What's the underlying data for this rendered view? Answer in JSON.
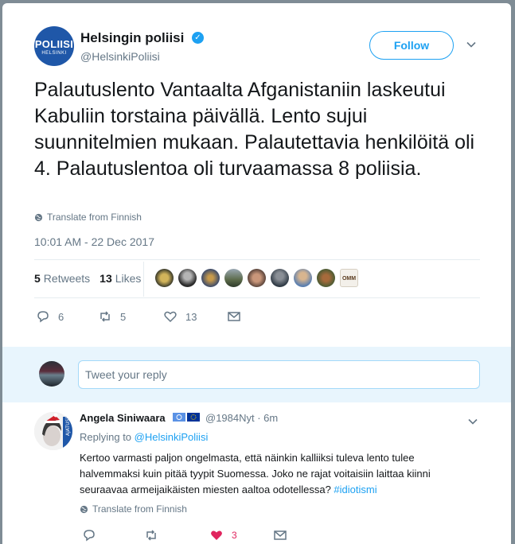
{
  "top_strip_text": "",
  "tweet": {
    "author_name": "Helsingin poliisi",
    "author_handle": "@HelsinkiPoliisi",
    "avatar_line1": "POLIISI",
    "avatar_line2": "HELSINKI",
    "follow_label": "Follow",
    "text": "Palautuslento Vantaalta Afganistaniin laskeutui Kabuliin torstaina päivällä. Lento sujui suunnitelmien mukaan. Palautettavia henkilöitä oli 4. Palautuslentoa oli turvaamassa 8 poliisia.",
    "translate_label": "Translate from Finnish",
    "timestamp": "10:01 AM - 22 Dec 2017",
    "retweets_count": "5",
    "retweets_label": "Retweets",
    "likes_count": "13",
    "likes_label": "Likes",
    "replies_action_count": "6",
    "retweets_action_count": "5",
    "likes_action_count": "13"
  },
  "reply_composer": {
    "placeholder": "Tweet your reply"
  },
  "reply": {
    "author_name": "Angela Siniwaara",
    "handle_time": "@1984Nyt · 6m",
    "replying_to_label": "Replying to",
    "replying_to_handle": "@HelsinkiPoliisi",
    "text": "Kertoo varmasti paljon ongelmasta, että näinkin kalliiksi tuleva lento tulee halvemmaksi kuin pitää tyypit Suomessa. Joko ne rajat voitaisiin laittaa kiinni seuraavaa armeijaikäisten miesten aaltoa odotellessa?",
    "hashtag": "#idiotismi",
    "translate_label": "Translate from Finnish",
    "likes_count": "3"
  },
  "colors": {
    "accent": "#1da1f2",
    "like_red": "#e0245e",
    "muted": "#657786",
    "brand_blue": "#1f57a8"
  }
}
